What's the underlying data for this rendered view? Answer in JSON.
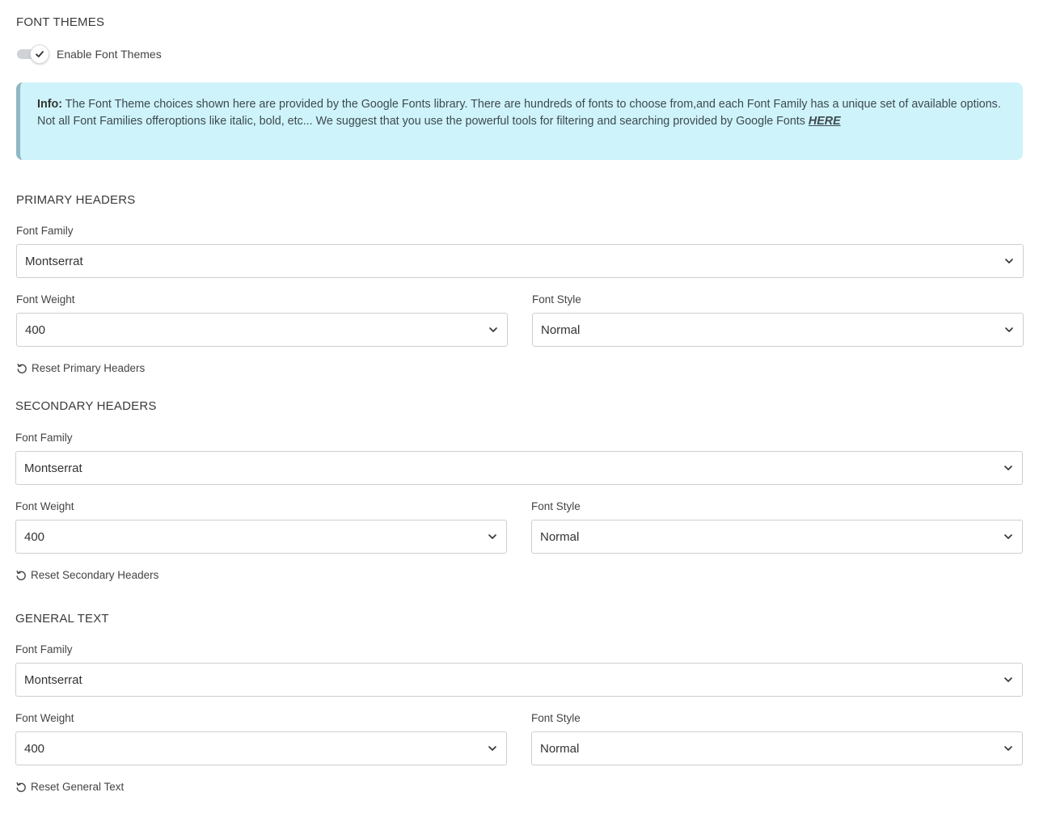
{
  "font_themes": {
    "title": "FONT THEMES",
    "toggle_label": "Enable Font Themes",
    "enabled": true
  },
  "info": {
    "prefix": "Info:",
    "body": " The Font Theme choices shown here are provided by the Google Fonts library. There are hundreds of fonts to choose from,and each Font Family has a unique set of available options. Not all Font Families offeroptions like italic, bold, etc... We suggest that you use the powerful tools for filtering and searching provided by Google Fonts ",
    "link_text": "HERE"
  },
  "sections": [
    {
      "title": "PRIMARY HEADERS",
      "family_label": "Font Family",
      "family_value": "Montserrat",
      "weight_label": "Font Weight",
      "weight_value": "400",
      "style_label": "Font Style",
      "style_value": "Normal",
      "reset_label": "Reset Primary Headers"
    },
    {
      "title": "SECONDARY HEADERS",
      "family_label": "Font Family",
      "family_value": "Montserrat",
      "weight_label": "Font Weight",
      "weight_value": "400",
      "style_label": "Font Style",
      "style_value": "Normal",
      "reset_label": "Reset Secondary Headers"
    },
    {
      "title": "GENERAL TEXT",
      "family_label": "Font Family",
      "family_value": "Montserrat",
      "weight_label": "Font Weight",
      "weight_value": "400",
      "style_label": "Font Style",
      "style_value": "Normal",
      "reset_label": "Reset General Text"
    }
  ],
  "icons": {
    "toggle": "check-icon",
    "select": "chevron-down-icon",
    "reset": "reset-icon"
  },
  "colors": {
    "info_background": "#cff3fa",
    "info_border": "#8fb8c4",
    "toggle_track": "#cfd3d8"
  }
}
